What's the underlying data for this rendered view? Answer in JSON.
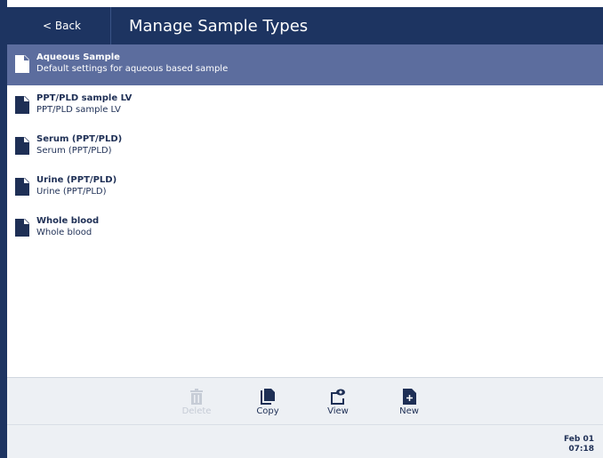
{
  "header": {
    "back_label": "< Back",
    "title": "Manage Sample Types"
  },
  "sample_types": [
    {
      "name": "Aqueous Sample",
      "description": "Default settings for aqueous based sample",
      "selected": true
    },
    {
      "name": "PPT/PLD sample LV",
      "description": "PPT/PLD sample LV",
      "selected": false
    },
    {
      "name": "Serum (PPT/PLD)",
      "description": "Serum (PPT/PLD)",
      "selected": false
    },
    {
      "name": "Urine (PPT/PLD)",
      "description": "Urine (PPT/PLD)",
      "selected": false
    },
    {
      "name": "Whole blood",
      "description": "Whole blood",
      "selected": false
    }
  ],
  "toolbar": {
    "delete_label": "Delete",
    "copy_label": "Copy",
    "view_label": "View",
    "new_label": "New",
    "delete_enabled": false
  },
  "status": {
    "date": "Feb 01",
    "time": "07:18"
  },
  "colors": {
    "header": "#1d3461",
    "selected_row": "#5c6d9e",
    "toolbar_bg": "#edf0f4"
  }
}
